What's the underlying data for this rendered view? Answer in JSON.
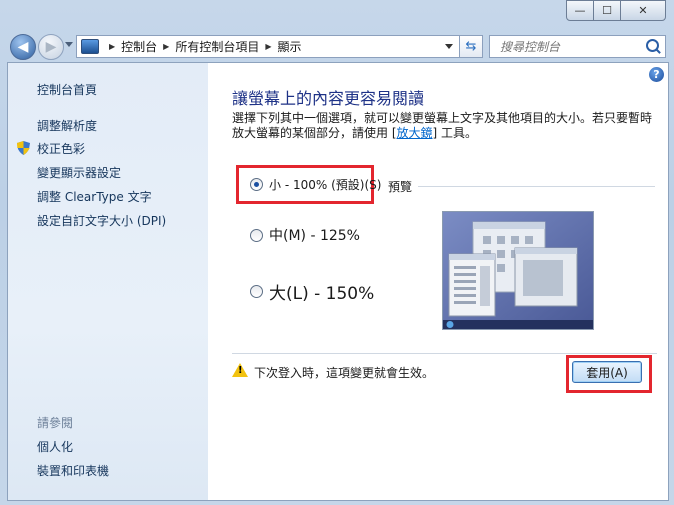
{
  "window": {
    "minimize_label": "—",
    "maximize_label": "☐",
    "close_label": "✕"
  },
  "address": {
    "breadcrumbs": [
      "控制台",
      "所有控制台項目",
      "顯示"
    ],
    "search_placeholder": "搜尋控制台"
  },
  "sidebar": {
    "items": [
      {
        "label": "控制台首頁"
      },
      {
        "label": "調整解析度"
      },
      {
        "label": "校正色彩"
      },
      {
        "label": "變更顯示器設定"
      },
      {
        "label": "調整 ClearType 文字"
      },
      {
        "label": "設定自訂文字大小 (DPI)"
      }
    ],
    "see_also_title": "請參閱",
    "see_also": [
      {
        "label": "個人化"
      },
      {
        "label": "裝置和印表機"
      }
    ]
  },
  "main": {
    "heading": "讓螢幕上的內容更容易閱讀",
    "description_pre": "選擇下列其中一個選項，就可以變更螢幕上文字及其他項目的大小。若只要暫時放大螢幕的某個部分，請使用 [",
    "description_link": "放大鏡",
    "description_post": "] 工具。",
    "options": [
      {
        "label": "小 - 100% (預設)(S)",
        "selected": true
      },
      {
        "label": "中(M) - 125%",
        "selected": false
      },
      {
        "label": "大(L) - 150%",
        "selected": false
      }
    ],
    "preview_label": "預覽",
    "warning_text": "下次登入時，這項變更就會生效。",
    "apply_label": "套用(A)",
    "help_label": "?"
  },
  "colors": {
    "highlight": "#e3262e",
    "heading": "#1e3287",
    "link": "#0066cc"
  }
}
